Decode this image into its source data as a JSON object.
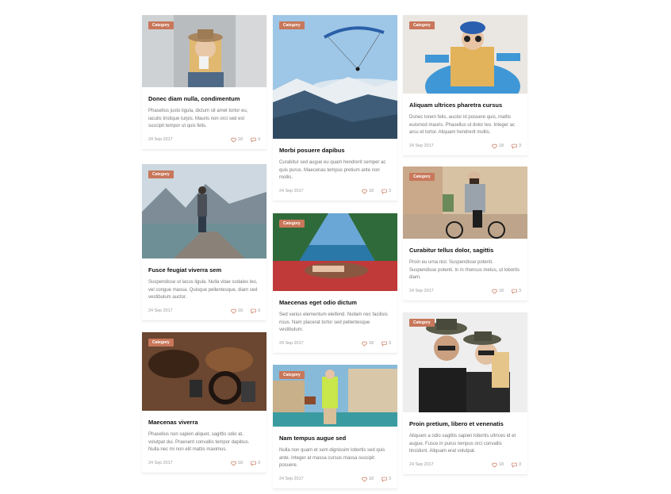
{
  "accent_color": "#c8775a",
  "posts": [
    {
      "category": "Category",
      "title": "Donec diam nulla, condimentum",
      "excerpt": "Phasellus justo ligula, dictum sit amet tortor eu, iaculis tristique turpis. Mauris non orci sed est suscipit tempor ut quis felis.",
      "date": "24 Sep 2017",
      "likes": "18",
      "comments": "3",
      "image": "woman-drinking-coffee"
    },
    {
      "category": "Category",
      "title": "Fusce feugiat viverra sem",
      "excerpt": "Suspendisse ut lacus ligula. Nulla vitae sodales leo, vel congue massa. Quisque pellentesque, diam sed vestibulum auctor.",
      "date": "24 Sep 2017",
      "likes": "18",
      "comments": "3",
      "image": "man-on-pier-mountains"
    },
    {
      "category": "Category",
      "title": "Maecenas viverra",
      "excerpt": "Phasellus non sapien aliquet, sagittis odio at, volutpat dui. Praesent convallis tempor dapibus. Nulla nec mi non elit mattis maximus.",
      "date": "24 Sep 2017",
      "likes": "18",
      "comments": "3",
      "image": "shoes-and-accessories"
    },
    {
      "category": "Category",
      "title": "Morbi posuere dapibus",
      "excerpt": "Curabitur sed augue eu quam hendrerit semper ac quis purus. Maecenas tempus pretium ante non mollis.",
      "date": "24 Sep 2017",
      "likes": "18",
      "comments": "3",
      "image": "paraglider-over-mountains"
    },
    {
      "category": "Category",
      "title": "Maecenas eget odio dictum",
      "excerpt": "Sed varius elementum eleifend. Nullam nec facilisis risus. Nam placerat tortor sed pellentesque vestibulum.",
      "date": "24 Sep 2017",
      "likes": "18",
      "comments": "3",
      "image": "tent-view-lake"
    },
    {
      "category": "Category",
      "title": "Nam tempus augue sed",
      "excerpt": "Nulla non quam et sem dignissim lobortis sed quis ante. Integer at massa cursus massa suscipit posuere.",
      "date": "24 Sep 2017",
      "likes": "18",
      "comments": "3",
      "image": "woman-in-street"
    },
    {
      "category": "Category",
      "title": "Aliquam ultrices pharetra cursus",
      "excerpt": "Donec lorem felis, auctor id posuere quis, mattis euismod mauris. Phasellus ut dolor leo. Integer ac arcu et tortor. Aliquam hendrerit mollis.",
      "date": "24 Sep 2017",
      "likes": "18",
      "comments": "3",
      "image": "woman-blue-hat"
    },
    {
      "category": "Category",
      "title": "Curabitur tellus dolor, sagittis",
      "excerpt": "Proin eu urna nisl. Suspendisse potenti. Suspendisse potenti. In in rhoncus metus, ut lobortis diam.",
      "date": "24 Sep 2017",
      "likes": "18",
      "comments": "3",
      "image": "man-on-bicycle"
    },
    {
      "category": "Category",
      "title": "Proin pretium, libero et venenatis",
      "excerpt": "Aliquam a odio sagittis sapien lobortis ultrices id et augue. Fusce in purus tempus orci convallis tincidunt. Aliquam erat volutpat.",
      "date": "24 Sep 2017",
      "likes": "18",
      "comments": "3",
      "image": "couple-in-hats"
    }
  ]
}
